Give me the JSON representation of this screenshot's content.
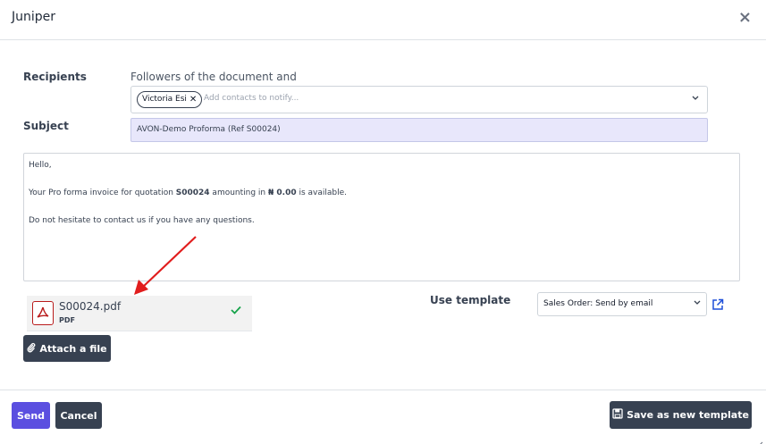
{
  "dialog": {
    "title": "Juniper",
    "close_symbol": "×"
  },
  "form": {
    "recipients_label": "Recipients",
    "followers_text": "Followers of the document and",
    "recipient_tags": [
      "Victoria Esi"
    ],
    "recipients_placeholder": "Add contacts to notify...",
    "subject_label": "Subject",
    "subject_value": "AVON-Demo Proforma (Ref S00024)"
  },
  "body": {
    "greeting": "Hello,",
    "line2_prefix": "Your Pro forma invoice for quotation ",
    "line2_ref": "S00024",
    "line2_mid": " amounting in ",
    "line2_amount": "₦ 0.00",
    "line2_suffix": " is available.",
    "line3": "Do not hesitate to contact us if you have any questions."
  },
  "attachment": {
    "filename": "S00024.pdf",
    "filetype": "PDF",
    "icon": "pdf-icon",
    "status_icon": "check-icon"
  },
  "attach_button": {
    "label": "Attach a file",
    "icon": "paperclip-icon"
  },
  "template": {
    "label": "Use template",
    "selected": "Sales Order: Send by email"
  },
  "footer": {
    "send_label": "Send",
    "cancel_label": "Cancel",
    "save_template_label": "Save as new template"
  },
  "colors": {
    "primary": "#5b4fe0",
    "dark_button": "#374151",
    "subject_bg": "#e8e7fb",
    "annotation_arrow": "#e11d1d",
    "success": "#16a34a"
  }
}
